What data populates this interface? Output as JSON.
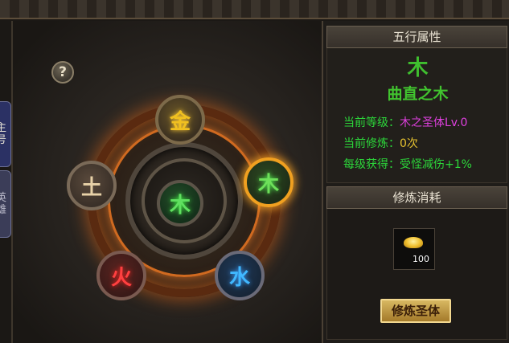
{
  "side_tabs": [
    {
      "label": "主号"
    },
    {
      "label": "英雄"
    }
  ],
  "wheel": {
    "help_label": "?",
    "elements": {
      "jin": "金",
      "tu": "土",
      "mu": "木",
      "huo": "火",
      "shui": "水",
      "center": "木"
    }
  },
  "attributes": {
    "header": "五行属性",
    "element_glyph": "木",
    "name": "曲直之木",
    "stats": [
      {
        "label": "当前等级：",
        "value": "木之圣体Lv.0",
        "color": "#e040e0"
      },
      {
        "label": "当前修炼：",
        "value": "0次",
        "color": "#e6c230"
      },
      {
        "label": "每级获得：",
        "value": "受怪减伤+1%",
        "color": "#2cd63a"
      }
    ]
  },
  "cost": {
    "header": "修炼消耗",
    "item_icon": "gold-ingot-icon",
    "item_count": "100",
    "button_label": "修炼圣体"
  }
}
